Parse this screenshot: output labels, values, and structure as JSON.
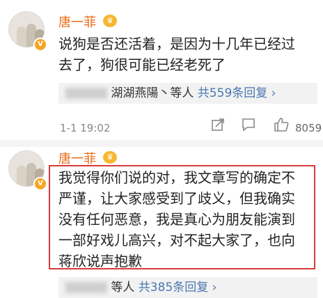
{
  "comments": [
    {
      "username": "唐一菲",
      "verified_badge": "V",
      "level_icon": "crown-icon",
      "text_lines": [
        "说狗是否还活着，是因为十几年已经过",
        "去了，狗很可能已经老死了"
      ],
      "replies": {
        "names": "湖湖燕陽丶等人",
        "count_label": "共559条回复",
        "arrow": "›"
      },
      "timestamp": "1-1 19:02",
      "like_count": "8059"
    },
    {
      "username": "唐一菲",
      "verified_badge": "V",
      "level_icon": "crown-icon",
      "text_lines": [
        "我觉得你们说的对，我文章写的确定不",
        "严谨，让大家感受到了歧义，但我确实",
        "没有任何恶意，我是真心为朋友能演到",
        "一部好戏儿高兴，对不起大家了，也向",
        "蒋欣说声抱歉"
      ],
      "replies": {
        "names": "等人",
        "count_label": "共385条回复",
        "arrow": "›"
      }
    }
  ],
  "colors": {
    "username": "#e86b16",
    "link": "#4a77b0",
    "highlight_border": "#d63a3a"
  }
}
